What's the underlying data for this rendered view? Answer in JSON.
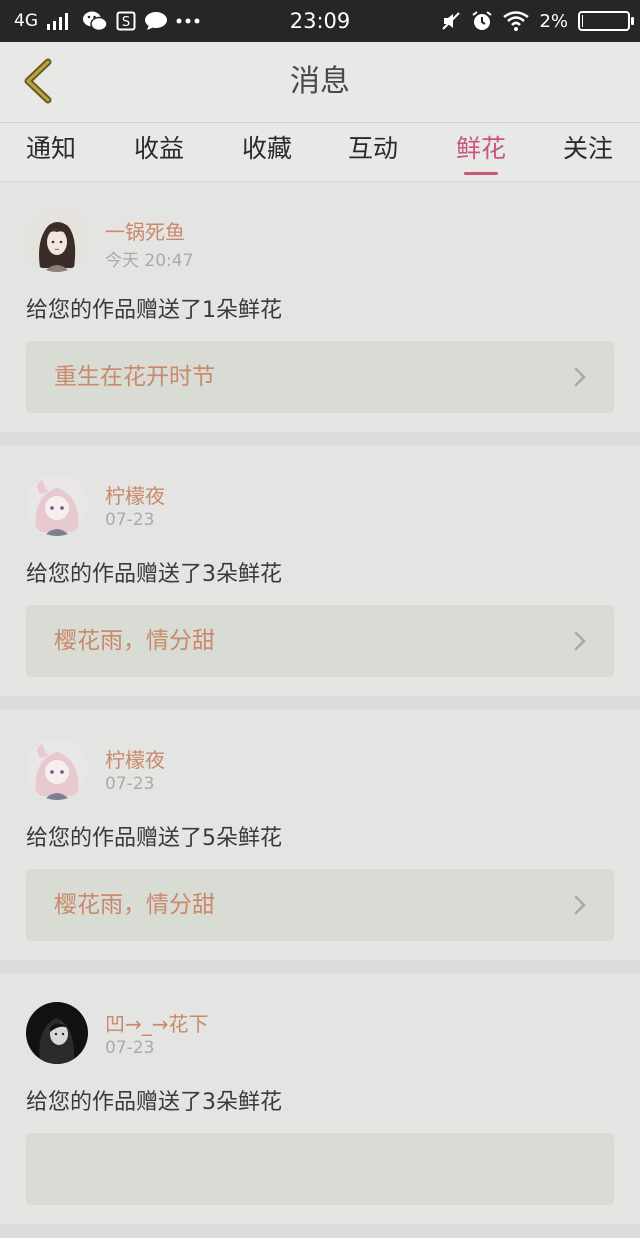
{
  "status_bar": {
    "network": "4G",
    "time": "23:09",
    "battery_text": "2%",
    "battery_level": 0.02,
    "left_icons": [
      "signal-icon",
      "wechat-icon",
      "s-app-icon",
      "chat-bubble-icon",
      "more-dots-icon"
    ],
    "right_icons": [
      "mute-icon",
      "alarm-icon",
      "wifi-icon",
      "battery-icon"
    ]
  },
  "header": {
    "title": "消息",
    "back_icon": "back-chevron-icon"
  },
  "tabs": [
    {
      "label": "通知",
      "active": false
    },
    {
      "label": "收益",
      "active": false
    },
    {
      "label": "收藏",
      "active": false
    },
    {
      "label": "互动",
      "active": false
    },
    {
      "label": "鲜花",
      "active": true
    },
    {
      "label": "关注",
      "active": false
    }
  ],
  "colors": {
    "accent": "#c8577a",
    "name": "#c9896a",
    "work_bg": "#d9dbd5"
  },
  "messages": [
    {
      "user": "一锅死鱼",
      "time": "今天 20:47",
      "text": "给您的作品赠送了1朵鲜花",
      "work": "重生在花开时节"
    },
    {
      "user": "柠檬夜",
      "time": "07-23",
      "text": "给您的作品赠送了3朵鲜花",
      "work": "樱花雨，情分甜"
    },
    {
      "user": "柠檬夜",
      "time": "07-23",
      "text": "给您的作品赠送了5朵鲜花",
      "work": "樱花雨，情分甜"
    },
    {
      "user": "凹→_→花下",
      "time": "07-23",
      "text": "给您的作品赠送了3朵鲜花",
      "work": ""
    }
  ]
}
